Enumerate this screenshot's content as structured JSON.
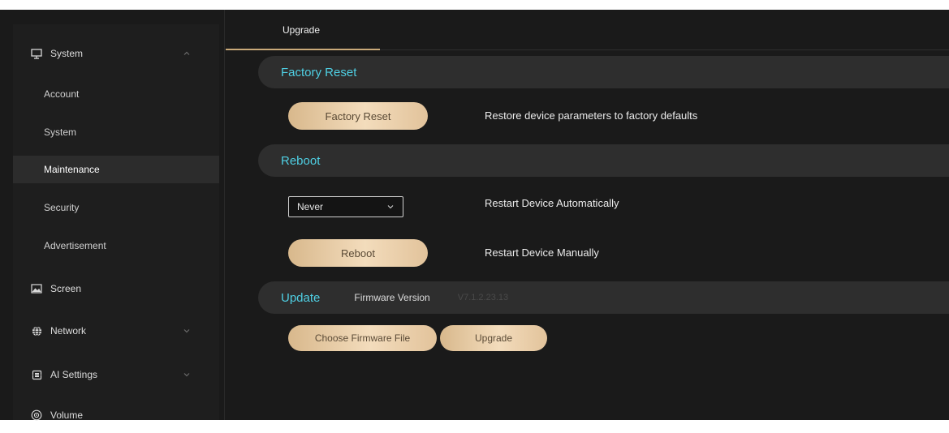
{
  "sidebar": {
    "system_group": {
      "label": "System",
      "icon": "monitor-icon"
    },
    "items": [
      {
        "label": "Account"
      },
      {
        "label": "System"
      },
      {
        "label": "Maintenance"
      },
      {
        "label": "Security"
      },
      {
        "label": "Advertisement"
      }
    ],
    "screen_group": {
      "label": "Screen",
      "icon": "image-icon"
    },
    "network_group": {
      "label": "Network",
      "icon": "globe-icon"
    },
    "ai_group": {
      "label": "AI Settings",
      "icon": "chip-icon"
    },
    "volume_group": {
      "label": "Volume",
      "icon": "speaker-icon"
    },
    "active_item": "Maintenance"
  },
  "tabs": [
    {
      "label": "Upgrade"
    }
  ],
  "factory_reset": {
    "title": "Factory Reset",
    "button_label": "Factory Reset",
    "description": "Restore device parameters to factory defaults"
  },
  "reboot": {
    "title": "Reboot",
    "auto_select_value": "Never",
    "auto_description": "Restart Device Automatically",
    "button_label": "Reboot",
    "manual_description": "Restart Device Manually"
  },
  "update": {
    "title": "Update",
    "firmware_label": "Firmware Version",
    "firmware_value": "V7.1.2.23.13",
    "choose_button_label": "Choose Firmware File",
    "upgrade_button_label": "Upgrade"
  },
  "colors": {
    "accent_cyan": "#4fd0e4",
    "accent_gold": "#c9a979",
    "background": "#1a1a1a"
  }
}
